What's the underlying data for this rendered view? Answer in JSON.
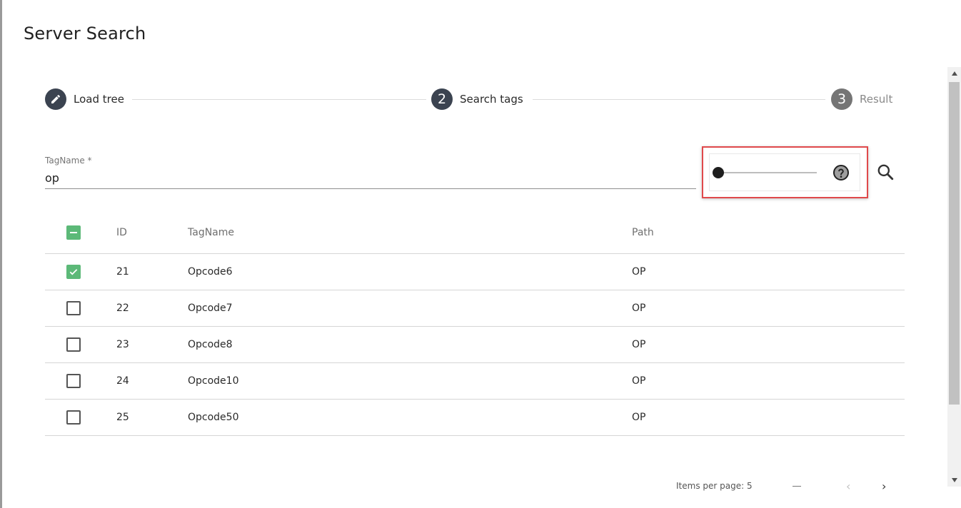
{
  "dialog": {
    "title": "Server Search"
  },
  "stepper": {
    "steps": [
      {
        "number": "",
        "label": "Load tree",
        "state": "done",
        "icon": "pencil-icon"
      },
      {
        "number": "2",
        "label": "Search tags",
        "state": "active"
      },
      {
        "number": "3",
        "label": "Result",
        "state": "pending"
      }
    ]
  },
  "search": {
    "field_label": "TagName *",
    "field_value": "op",
    "slider_value": 0,
    "help_icon": "question-circle-icon",
    "search_icon": "magnify-icon"
  },
  "table": {
    "headers": {
      "id": "ID",
      "tagname": "TagName",
      "path": "Path"
    },
    "header_checkbox": "indeterminate",
    "rows": [
      {
        "id": "21",
        "tagname": "Opcode6",
        "path": "OP",
        "checked": true
      },
      {
        "id": "22",
        "tagname": "Opcode7",
        "path": "OP",
        "checked": false
      },
      {
        "id": "23",
        "tagname": "Opcode8",
        "path": "OP",
        "checked": false
      },
      {
        "id": "24",
        "tagname": "Opcode10",
        "path": "OP",
        "checked": false
      },
      {
        "id": "25",
        "tagname": "Opcode50",
        "path": "OP",
        "checked": false
      }
    ]
  },
  "paginator": {
    "items_per_page_label": "Items per page: 5"
  },
  "colors": {
    "step_circle": "#3b4350",
    "checkbox_accent": "#5cb978",
    "highlight_border": "#e0494b"
  }
}
